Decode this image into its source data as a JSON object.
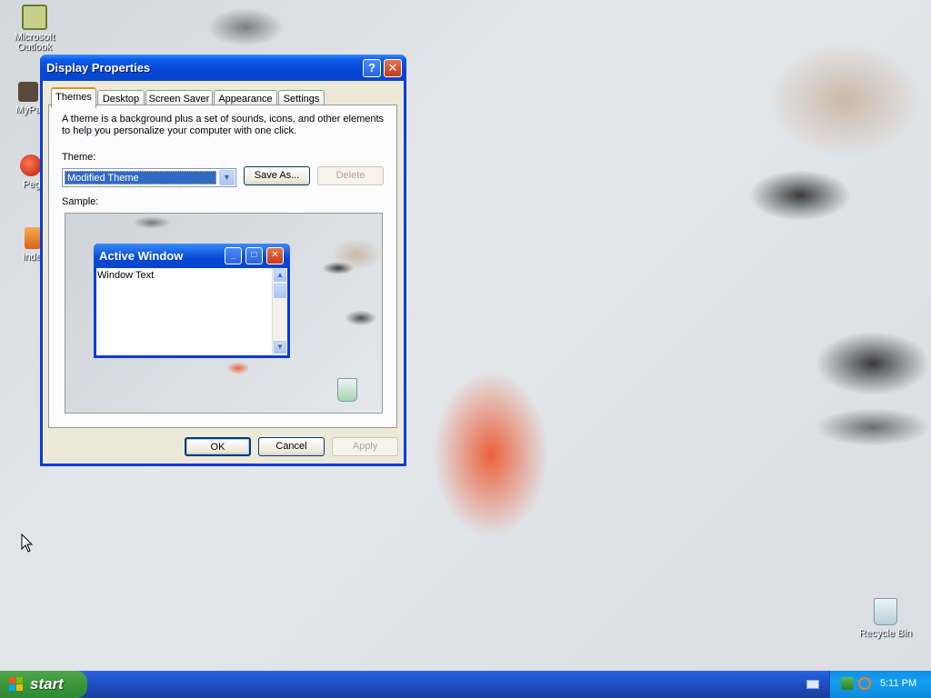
{
  "desktop": {
    "icons": [
      {
        "label": "Microsoft Outlook",
        "icon": "outlook-icon"
      },
      {
        "label": "MyPa",
        "icon": "shortcut-icon"
      },
      {
        "label": "Peg",
        "icon": "game-icon"
      },
      {
        "label": "inde",
        "icon": "file-icon"
      },
      {
        "label": "Recycle Bin",
        "icon": "recycle-bin-icon"
      }
    ]
  },
  "dialog": {
    "title": "Display Properties",
    "help_label": "?",
    "close_label": "✕",
    "tabs": [
      "Themes",
      "Desktop",
      "Screen Saver",
      "Appearance",
      "Settings"
    ],
    "description": "A theme is a background plus a set of sounds, icons, and other elements to help you personalize your computer with one click.",
    "theme_label": "Theme:",
    "theme_value": "Modified Theme",
    "save_as_label": "Save As...",
    "delete_label": "Delete",
    "sample_label": "Sample:",
    "sample_window": {
      "title": "Active Window",
      "text": "Window Text"
    },
    "ok_label": "OK",
    "cancel_label": "Cancel",
    "apply_label": "Apply"
  },
  "taskbar": {
    "start_label": "start",
    "clock": "5:11 PM"
  }
}
